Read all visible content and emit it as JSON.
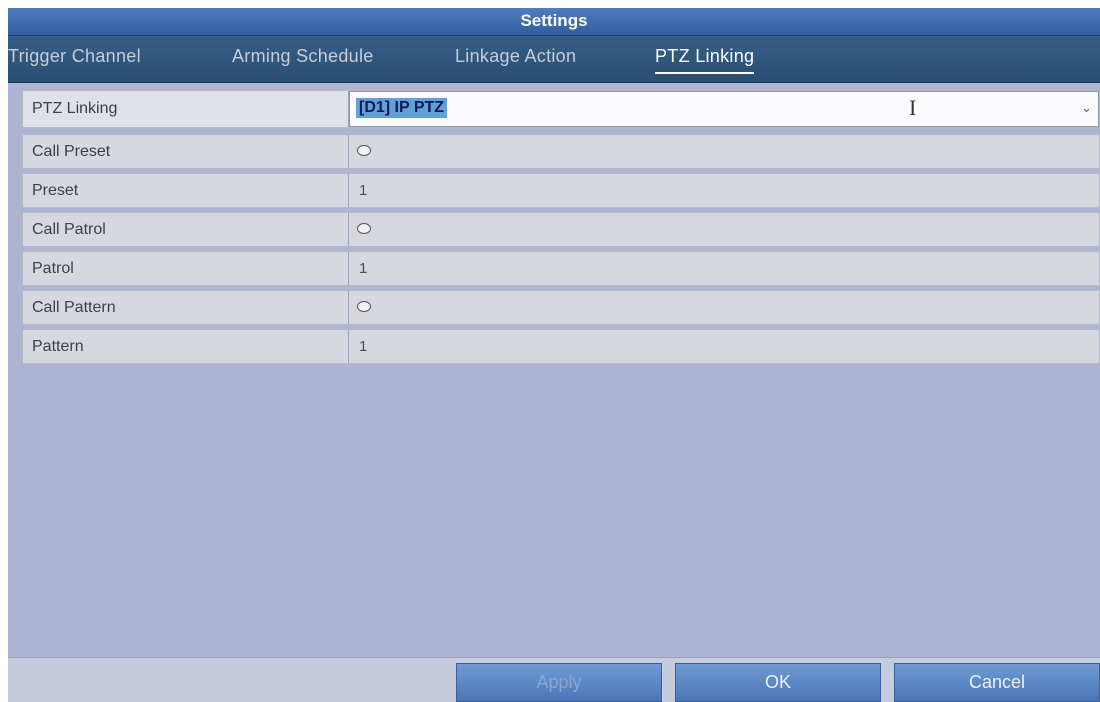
{
  "window": {
    "title": "Settings"
  },
  "tabs": [
    {
      "label": "Trigger Channel"
    },
    {
      "label": "Arming Schedule"
    },
    {
      "label": "Linkage Action"
    },
    {
      "label": "PTZ Linking",
      "active": true
    }
  ],
  "form": {
    "ptz_linking": {
      "label": "PTZ Linking",
      "value": "[D1] IP PTZ"
    },
    "call_preset": {
      "label": "Call Preset",
      "checked": false
    },
    "preset": {
      "label": "Preset",
      "value": "1"
    },
    "call_patrol": {
      "label": "Call Patrol",
      "checked": false
    },
    "patrol": {
      "label": "Patrol",
      "value": "1"
    },
    "call_pattern": {
      "label": "Call Pattern",
      "checked": false
    },
    "pattern": {
      "label": "Pattern",
      "value": "1"
    }
  },
  "buttons": {
    "apply": "Apply",
    "ok": "OK",
    "cancel": "Cancel"
  },
  "icons": {
    "cursor": "text-cursor-icon",
    "dropdown": "chevron-down-icon",
    "radio": "radio-icon"
  },
  "colors": {
    "title_bar": "#3d6eb3",
    "tab_bar": "#2f5479",
    "background": "#adb5d2",
    "button": "#5b86c6"
  }
}
